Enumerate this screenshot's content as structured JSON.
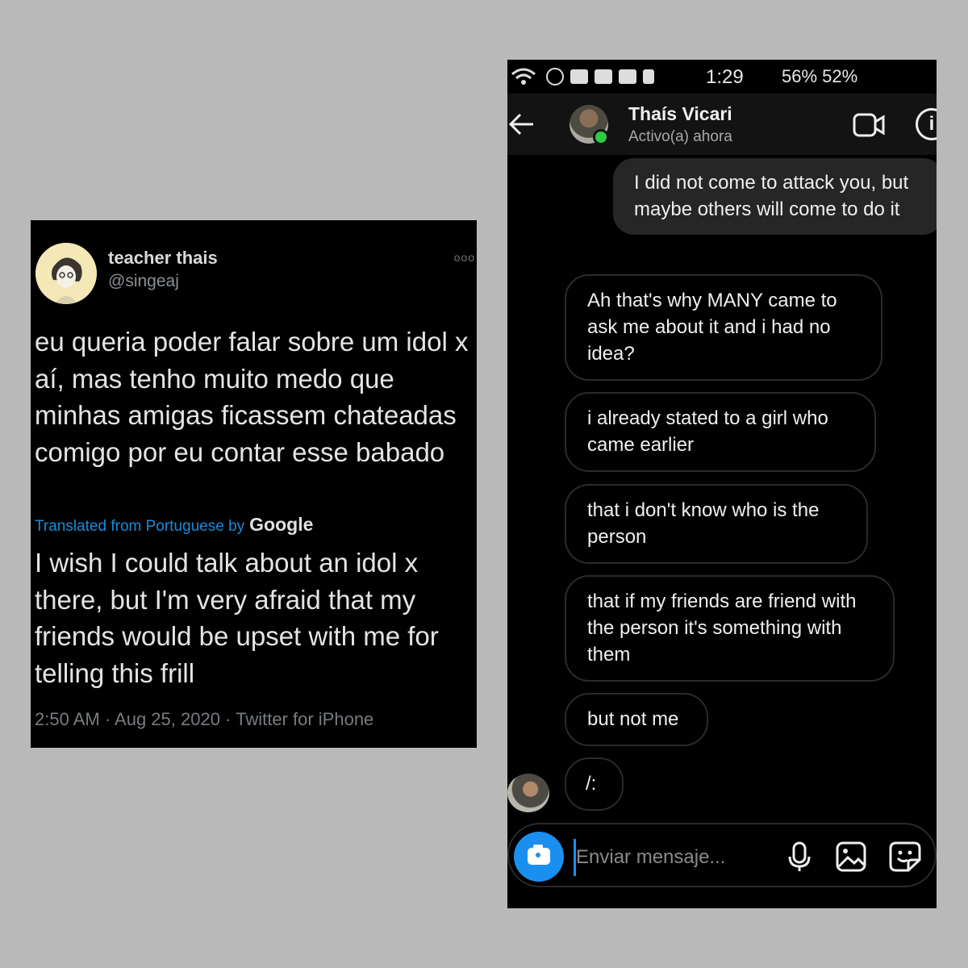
{
  "tweet": {
    "display_name": "teacher thais",
    "handle": "@singeaj",
    "more_glyph": "ooo",
    "text": "eu queria poder falar sobre um idol x aí, mas tenho muito medo que minhas amigas ficassem chateadas comigo por eu contar esse babado",
    "translation_label": "Translated from Portuguese by",
    "translation_provider": "Google",
    "translated_text": "I wish I could talk about an idol x there, but I'm very afraid that my friends would be upset with me for telling this frill",
    "meta": "2:50 AM · Aug 25, 2020 · Twitter for iPhone"
  },
  "phone": {
    "status_bar": {
      "time": "1:29",
      "right": "56% 52%"
    },
    "header": {
      "back_icon": "arrow-left-icon",
      "contact_name": "Thaís Vicari",
      "contact_status": "Activo(a) ahora",
      "video_icon": "video-call-icon",
      "info_icon": "info-icon",
      "info_glyph": "i"
    },
    "messages": [
      {
        "direction": "out",
        "text": "I did not come to attack you, but maybe others will come to do it"
      },
      {
        "direction": "in",
        "text": "Ah that's why MANY came to ask me about it and i had no idea?"
      },
      {
        "direction": "in",
        "text": "i already stated to a girl who came earlier"
      },
      {
        "direction": "in",
        "text": "that i don't know who is the person"
      },
      {
        "direction": "in",
        "text": "that if my friends are friend with the person it's something with them"
      },
      {
        "direction": "in",
        "text": "but not me"
      },
      {
        "direction": "in",
        "text": "/:"
      }
    ],
    "composer": {
      "placeholder": "Enviar mensaje...",
      "camera_icon": "camera-icon",
      "mic_icon": "microphone-icon",
      "gallery_icon": "image-icon",
      "sticker_icon": "sticker-icon"
    }
  },
  "colors": {
    "page_background": "#b9b9b9",
    "translation_link": "#1d8ad6",
    "accent_blue": "#1a8ff0",
    "online_green": "#2ecc40"
  }
}
